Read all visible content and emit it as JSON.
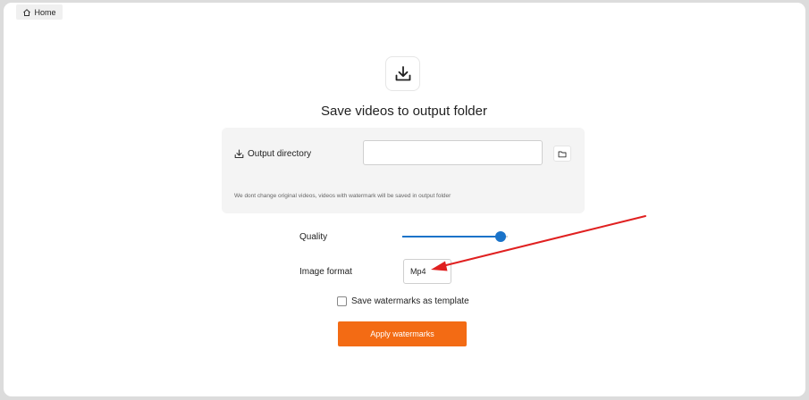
{
  "tab": {
    "label": "Home",
    "icon": "home-icon"
  },
  "hero": {
    "icon": "download-icon",
    "title": "Save videos to output folder"
  },
  "output": {
    "icon": "download-icon",
    "label": "Output directory",
    "value": "",
    "browse_icon": "folder-icon",
    "note": "We dont change original videos, videos with watermark will be saved in output folder"
  },
  "quality": {
    "label": "Quality",
    "value_percent": 93
  },
  "format": {
    "label": "Image format",
    "value": "Mp4"
  },
  "template": {
    "label": "Save watermarks as template",
    "checked": false
  },
  "apply": {
    "label": "Apply watermarks"
  },
  "annotation": {
    "type": "arrow",
    "color": "#e02020"
  },
  "colors": {
    "accent": "#1a73c9",
    "button": "#f36b14"
  }
}
